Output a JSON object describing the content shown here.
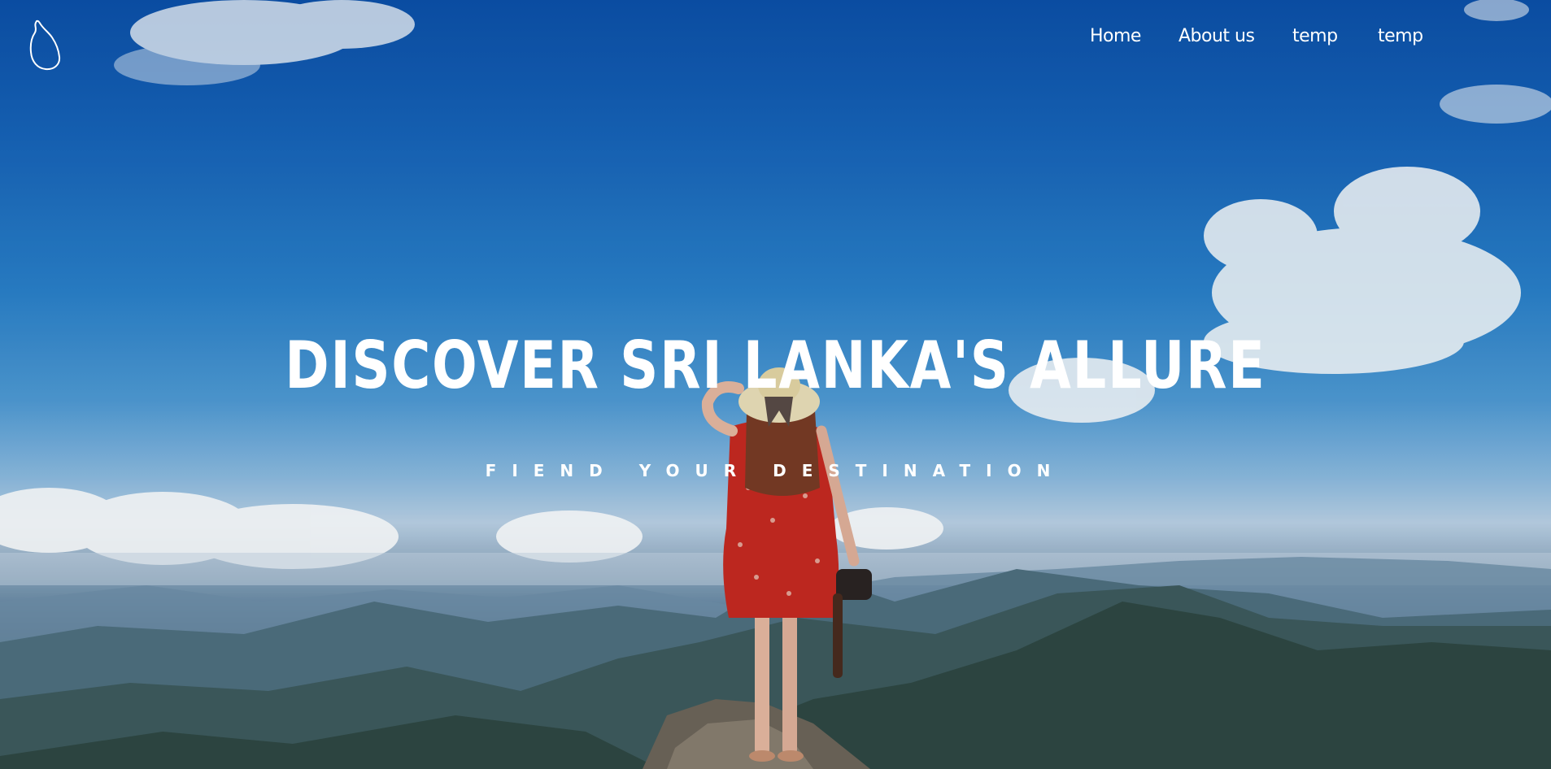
{
  "nav": {
    "items": [
      {
        "label": "Home"
      },
      {
        "label": "About us"
      },
      {
        "label": "temp"
      },
      {
        "label": "temp"
      }
    ]
  },
  "hero": {
    "title": "DISCOVER SRI LANKA'S ALLURE",
    "subtitle": "FIEND YOUR DESTINATION"
  },
  "icons": {
    "logo": "sri-lanka-outline-icon"
  },
  "colors": {
    "sky_top": "#0b4fa8",
    "sky_mid": "#4f9ad4",
    "mountains": "#2d4346",
    "dress": "#c8281e",
    "text": "#ffffff"
  }
}
